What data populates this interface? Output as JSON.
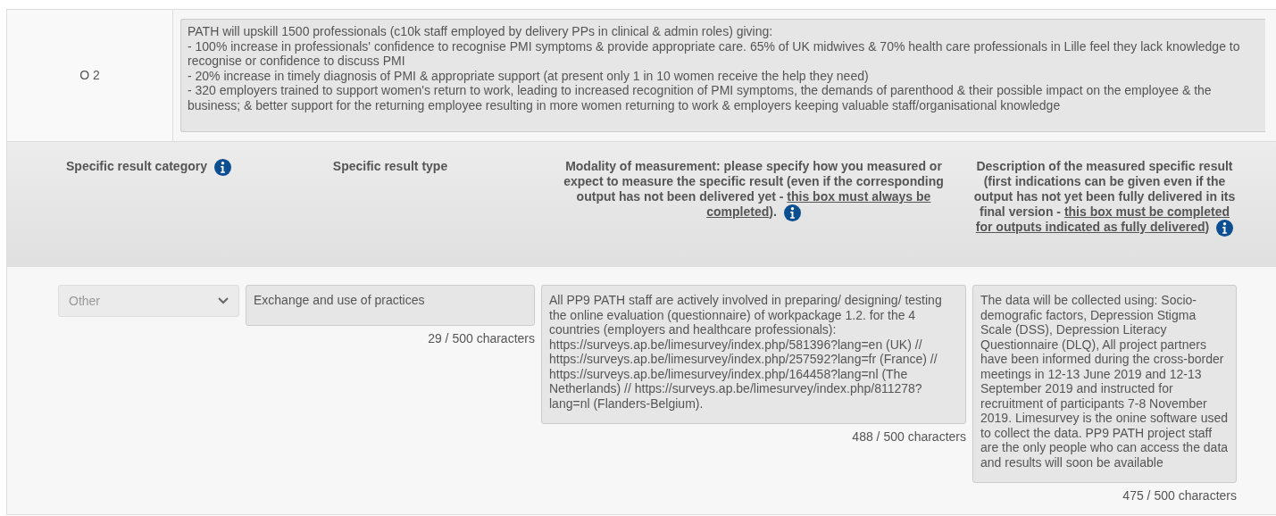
{
  "objective": {
    "code": "O 2",
    "lines": [
      "PATH will upskill 1500 professionals (c10k staff employed by delivery PPs in clinical & admin roles) giving:",
      "- 100% increase in professionals' confidence to recognise PMI symptoms & provide appropriate care. 65% of UK midwives & 70% health care professionals in Lille feel they lack knowledge to recognise or confidence to discuss PMI",
      "- 20% increase in timely diagnosis of PMI & appropriate support (at present only 1 in 10 women receive the help they need)",
      "- 320 employers trained to support women's return to work, leading to increased recognition of PMI symptoms, the demands of parenthood & their possible impact on the employee & the business; & better support for the returning employee resulting in more women returning to work & employers keeping valuable staff/organisational knowledge"
    ]
  },
  "columns": [
    {
      "title": "Specific result category",
      "info": true
    },
    {
      "title": "Specific result type",
      "info": false
    },
    {
      "title": "Modality of measurement: please specify how you measured or expect to measure the specific result (even if the corresponding output has not been delivered yet - ",
      "underlined_note": "this box must always be completed",
      "title_end": ").",
      "info": true
    },
    {
      "title": "Description of the measured specific result (first indications can be given even if the output has not yet been fully delivered in its final version - ",
      "underlined_note": "this box must be completed for outputs indicated as fully delivered",
      "title_end": ")",
      "info": true
    }
  ],
  "result_row": {
    "category": {
      "value": "Other",
      "disabled": true
    },
    "fields": [
      {
        "value": "Exchange and use of practices",
        "counter": "29 / 500 characters"
      },
      {
        "value": "All PP9 PATH staff are actively involved in preparing/ designing/ testing the online evaluation (questionnaire) of workpackage 1.2. for the 4 countries (employers and healthcare professionals): https://surveys.ap.be/limesurvey/index.php/581396?lang=en (UK) // https://surveys.ap.be/limesurvey/index.php/257592?lang=fr (France) // https://surveys.ap.be/limesurvey/index.php/164458?lang=nl (The Netherlands) // https://surveys.ap.be/limesurvey/index.php/811278?lang=nl (Flanders-Belgium).",
        "counter": "488 / 500 characters"
      },
      {
        "value": "The data will be collected using: Socio-demografic factors, Depression Stigma Scale (DSS), Depression Literacy Questionnaire (DLQ), All project partners have been informed during the cross-border meetings in 12-13 June 2019 and 12-13 September 2019 and instructed for recruitment of participants 7-8 November 2019. Limesurvey is the onine software used to collect the data. PP9 PATH project staff are the only people who can access the data and results will soon be available",
        "counter": "475 / 500 characters"
      }
    ]
  }
}
